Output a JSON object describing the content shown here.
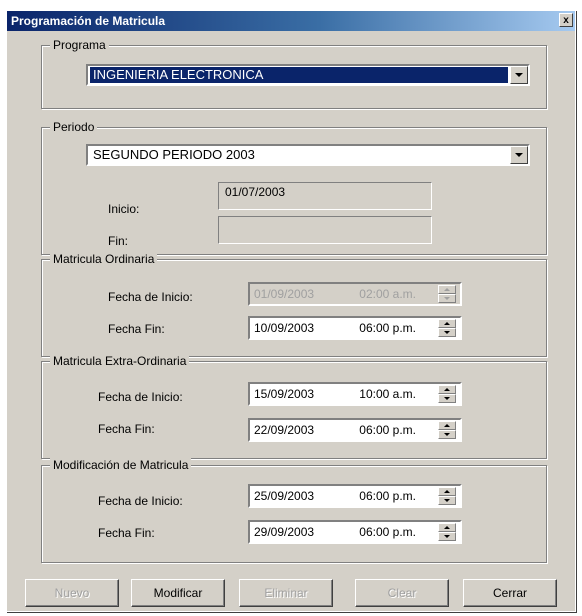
{
  "window": {
    "title": "Programación de Matricula",
    "close_glyph": "x"
  },
  "programa": {
    "legend": "Programa",
    "selected": "INGENIERIA ELECTRONICA"
  },
  "periodo": {
    "legend": "Periodo",
    "selected": "SEGUNDO PERIODO 2003",
    "inicio_label": "Inicio:",
    "inicio_value": "01/07/2003",
    "fin_label": "Fin:",
    "fin_value": ""
  },
  "ordinaria": {
    "legend": "Matricula Ordinaria",
    "start_label": "Fecha de Inicio:",
    "start_date": "01/09/2003",
    "start_time": "02:00 a.m.",
    "end_label": "Fecha Fin:",
    "end_date": "10/09/2003",
    "end_time": "06:00 p.m."
  },
  "extraordinaria": {
    "legend": "Matricula Extra-Ordinaria",
    "start_label": "Fecha de Inicio:",
    "start_date": "15/09/2003",
    "start_time": "10:00 a.m.",
    "end_label": "Fecha Fin:",
    "end_date": "22/09/2003",
    "end_time": "06:00 p.m."
  },
  "modificacion": {
    "legend": "Modificación de Matricula",
    "start_label": "Fecha de Inicio:",
    "start_date": "25/09/2003",
    "start_time": "06:00 p.m.",
    "end_label": "Fecha Fin:",
    "end_date": "29/09/2003",
    "end_time": "06:00 p.m."
  },
  "buttons": {
    "nuevo": "Nuevo",
    "modificar": "Modificar",
    "eliminar": "Eliminar",
    "clear": "Clear",
    "cerrar": "Cerrar"
  }
}
